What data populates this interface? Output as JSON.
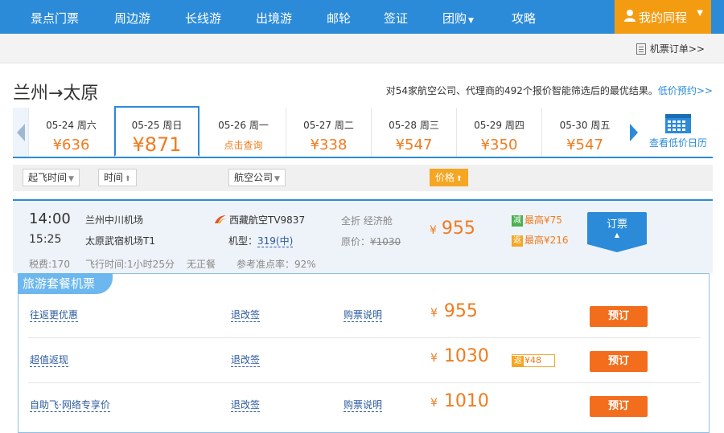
{
  "nav": {
    "items": [
      "景点门票",
      "周边游",
      "长线游",
      "出境游",
      "邮轮",
      "签证",
      "团购",
      "攻略"
    ],
    "my_trip": "我的同程"
  },
  "subbar": {
    "order_link": "机票订单>>"
  },
  "route": "兰州→太原",
  "summary": {
    "text": "对54家航空公司、代理商的492个报价智能筛选后的最优结果。",
    "low_price_link": "低价预约>>"
  },
  "dates": [
    {
      "date": "05-24 周六",
      "price": "¥636"
    },
    {
      "date": "05-25 周日",
      "price": "¥871"
    },
    {
      "date": "05-26 周一",
      "price": "点击查询"
    },
    {
      "date": "05-27 周二",
      "price": "¥338"
    },
    {
      "date": "05-28 周三",
      "price": "¥547"
    },
    {
      "date": "05-29 周四",
      "price": "¥350"
    },
    {
      "date": "05-30 周五",
      "price": "¥547"
    }
  ],
  "calendar_label": "查看低价日历",
  "filters": {
    "depart_time": "起飞时间",
    "time": "时间",
    "airline": "航空公司",
    "price": "价格"
  },
  "flight": {
    "dep_time": "14:00",
    "arr_time": "15:25",
    "dep_airport": "兰州中川机场",
    "arr_airport": "太原武宿机场T1",
    "airline": "西藏航空TV9837",
    "model_label": "机型：",
    "model": "319(中)",
    "cabin": "全折  经济舱",
    "orig_label": "原价：",
    "orig_price": "¥1030",
    "price": "955",
    "currency": "¥",
    "discount_chip": "减",
    "discount": "最高¥75",
    "rebate_chip": "返",
    "rebate": "最高¥216",
    "book": "订票",
    "tax": "税费:170",
    "duration": "飞行时间:1小时25分",
    "meal": "无正餐",
    "ontime": "参考准点率：92%"
  },
  "package": {
    "title": "旅游套餐机票",
    "rows": [
      {
        "name": "往返更优惠",
        "refund": "退改签",
        "note": "购票说明",
        "price": "955",
        "rebate": "",
        "book": "预订"
      },
      {
        "name": "超值返现",
        "refund": "退改签",
        "note": "",
        "price": "1030",
        "rebate": "¥48",
        "book": "预订"
      },
      {
        "name": "自助飞·网络专享价",
        "refund": "退改签",
        "note": "购票说明",
        "price": "1010",
        "rebate": "",
        "book": "预订"
      }
    ]
  },
  "colors": {
    "brand_blue": "#2b8bd9",
    "price_orange": "#f07b1e",
    "button_orange": "#f26e1d"
  }
}
